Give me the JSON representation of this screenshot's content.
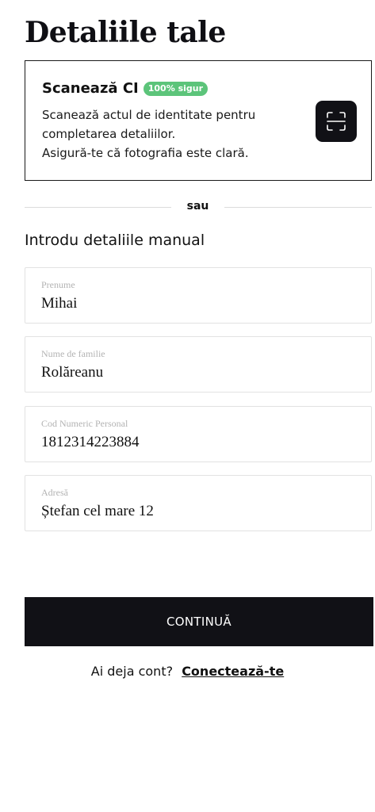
{
  "page": {
    "title": "Detaliile tale"
  },
  "scan": {
    "title": "Scanează CI",
    "badge": "100% sigur",
    "description_line1": "Scanează actul de identitate pentru completarea detaliilor.",
    "description_line2": "Asigură-te că fotografia este clară.",
    "icon": "scan-icon"
  },
  "divider": {
    "text": "sau"
  },
  "manual": {
    "heading": "Introdu detaliile manual",
    "fields": [
      {
        "label": "Prenume",
        "value": "Mihai"
      },
      {
        "label": "Nume de familie",
        "value": "Rolăreanu"
      },
      {
        "label": "Cod Numeric Personal",
        "value": "1812314223884"
      },
      {
        "label": "Adresă",
        "value": "Ștefan cel mare 12"
      }
    ]
  },
  "actions": {
    "continue_label": "CONTINUĂ",
    "login_prompt": "Ai deja cont?",
    "login_link": "Conectează-te"
  },
  "colors": {
    "primary": "#111116",
    "badge": "#5cc47a",
    "border": "#e2e2e2"
  }
}
